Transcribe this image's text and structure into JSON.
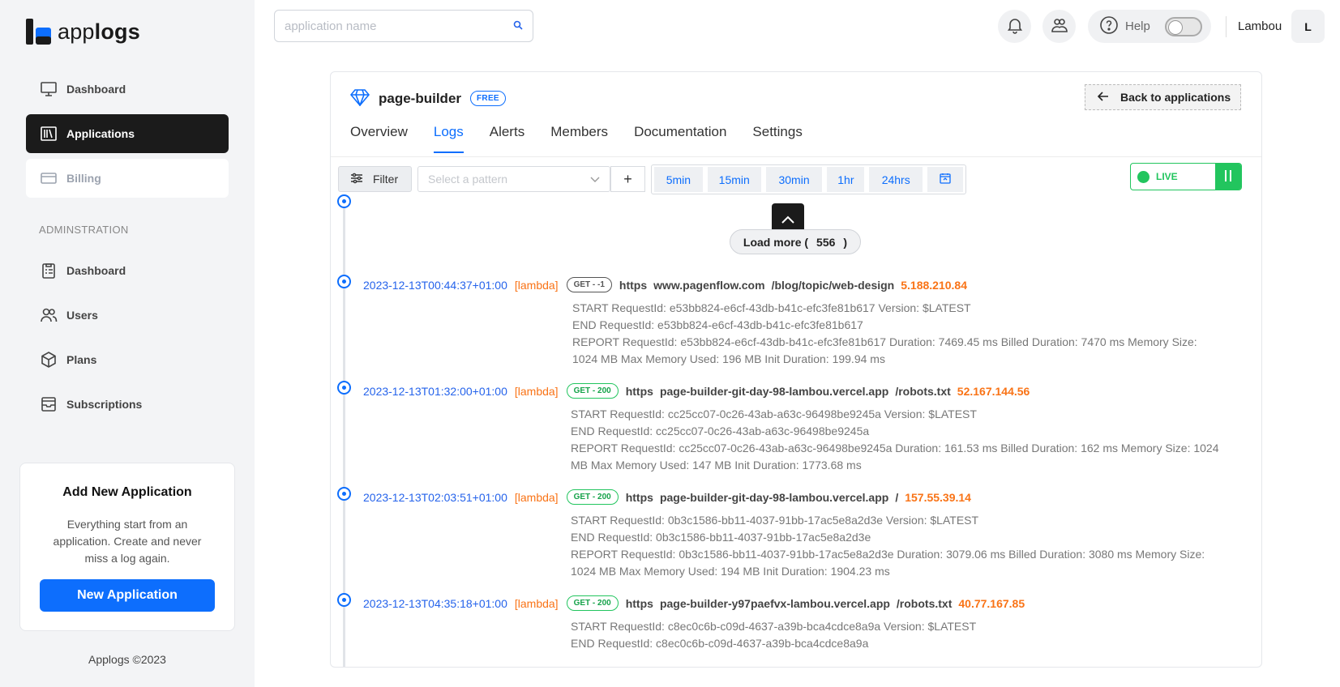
{
  "brand": {
    "prefix": "app",
    "suffix": "logs"
  },
  "sidebar": {
    "items": [
      {
        "label": "Dashboard"
      },
      {
        "label": "Applications"
      },
      {
        "label": "Billing"
      }
    ],
    "section_label": "ADMINSTRATION",
    "admin_items": [
      {
        "label": "Dashboard"
      },
      {
        "label": "Users"
      },
      {
        "label": "Plans"
      },
      {
        "label": "Subscriptions"
      }
    ],
    "promo": {
      "title": "Add New Application",
      "description": "Everything start from an application. Create and never miss a log again.",
      "button": "New Application"
    },
    "copyright": "Applogs ©2023"
  },
  "header": {
    "search_placeholder": "application name",
    "help_label": "Help",
    "user_name": "Lambou",
    "avatar_initial": "L"
  },
  "app": {
    "name": "page-builder",
    "plan_badge": "FREE",
    "back_label": "Back to applications",
    "tabs": [
      {
        "label": "Overview"
      },
      {
        "label": "Logs"
      },
      {
        "label": "Alerts"
      },
      {
        "label": "Members"
      },
      {
        "label": "Documentation"
      },
      {
        "label": "Settings"
      }
    ]
  },
  "toolbar": {
    "filter_label": "Filter",
    "pattern_placeholder": "Select a pattern",
    "plus_label": "+",
    "time_ranges": [
      "5min",
      "15min",
      "30min",
      "1hr",
      "24hrs"
    ],
    "live_label": "LIVE"
  },
  "load_more": {
    "label": "Load more (",
    "count": "556",
    "close": ")"
  },
  "logs": [
    {
      "timestamp": "2023-12-13T00:44:37+01:00",
      "source": "[lambda]",
      "method": "GET - -1",
      "protocol": "https",
      "host": "www.pagenflow.com",
      "path": "/blog/topic/web-design",
      "ip": "5.188.210.84",
      "lines": [
        "START RequestId: e53bb824-e6cf-43db-b41c-efc3fe81b617 Version: $LATEST",
        "END RequestId: e53bb824-e6cf-43db-b41c-efc3fe81b617",
        "REPORT RequestId: e53bb824-e6cf-43db-b41c-efc3fe81b617    Duration: 7469.45 ms Billed Duration: 7470 ms    Memory Size: 1024 MB Max Memory Used: 196 MB  Init Duration: 199.94 ms"
      ]
    },
    {
      "timestamp": "2023-12-13T01:32:00+01:00",
      "source": "[lambda]",
      "method": "GET - 200",
      "protocol": "https",
      "host": "page-builder-git-day-98-lambou.vercel.app",
      "path": "/robots.txt",
      "ip": "52.167.144.56",
      "lines": [
        "START RequestId: cc25cc07-0c26-43ab-a63c-96498be9245a Version: $LATEST",
        "END RequestId: cc25cc07-0c26-43ab-a63c-96498be9245a",
        "REPORT RequestId: cc25cc07-0c26-43ab-a63c-96498be9245a Duration: 161.53 ms    Billed Duration: 162 ms  Memory Size: 1024 MB  Max Memory Used: 147 MB  Init Duration: 1773.68 ms"
      ]
    },
    {
      "timestamp": "2023-12-13T02:03:51+01:00",
      "source": "[lambda]",
      "method": "GET - 200",
      "protocol": "https",
      "host": "page-builder-git-day-98-lambou.vercel.app",
      "path": "/",
      "ip": "157.55.39.14",
      "lines": [
        "START RequestId: 0b3c1586-bb11-4037-91bb-17ac5e8a2d3e Version: $LATEST",
        "END RequestId: 0b3c1586-bb11-4037-91bb-17ac5e8a2d3e",
        "REPORT RequestId: 0b3c1586-bb11-4037-91bb-17ac5e8a2d3e   Duration: 3079.06 ms    Billed Duration: 3080 ms    Memory Size: 1024 MB Max Memory Used: 194 MB  Init Duration: 1904.23 ms"
      ]
    },
    {
      "timestamp": "2023-12-13T04:35:18+01:00",
      "source": "[lambda]",
      "method": "GET - 200",
      "protocol": "https",
      "host": "page-builder-y97paefvx-lambou.vercel.app",
      "path": "/robots.txt",
      "ip": "40.77.167.85",
      "lines": [
        "START RequestId: c8ec0c6b-c09d-4637-a39b-bca4cdce8a9a Version: $LATEST",
        "END RequestId: c8ec0c6b-c09d-4637-a39b-bca4cdce8a9a"
      ]
    }
  ],
  "colors": {
    "accent": "#0d6efd",
    "live": "#22c55e",
    "ip": "#f97316",
    "timestamp": "#2563eb"
  }
}
